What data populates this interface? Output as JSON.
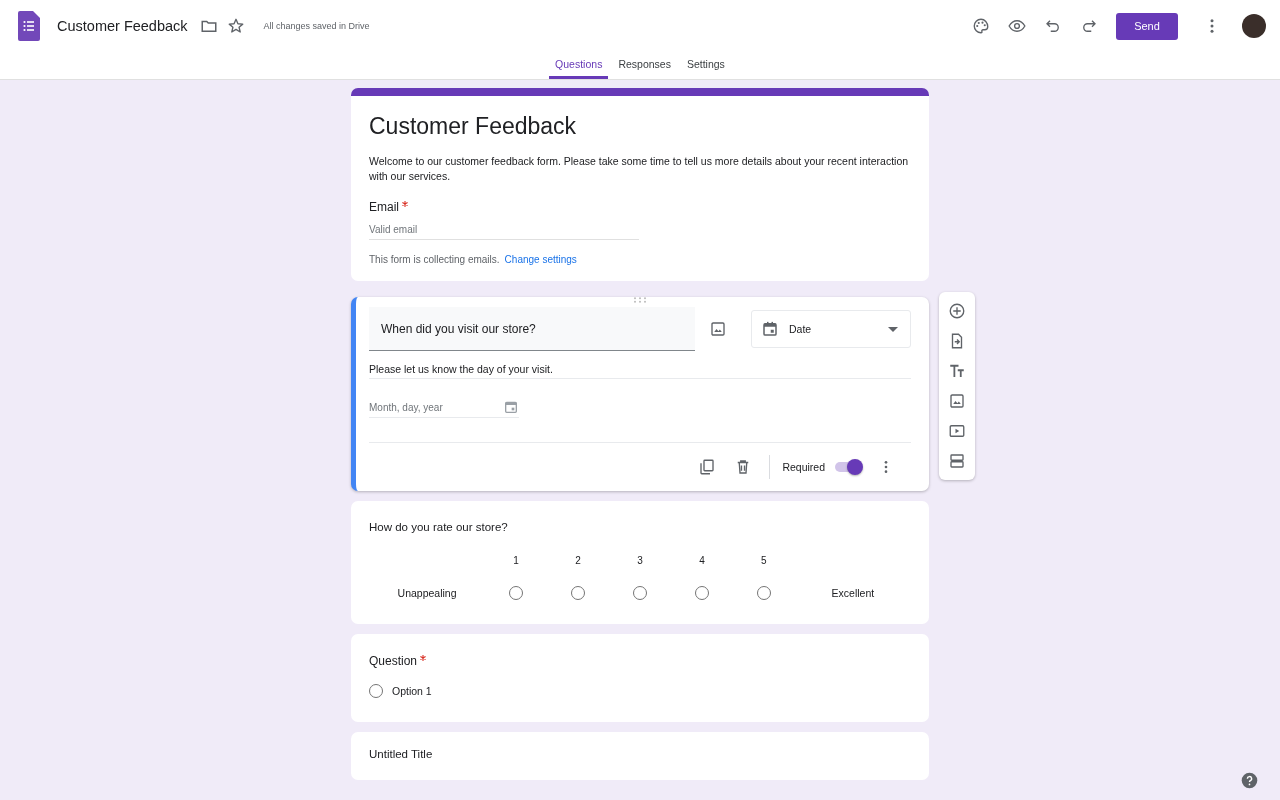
{
  "header": {
    "title": "Customer Feedback",
    "save_status": "All changes saved in Drive",
    "send_label": "Send"
  },
  "tabs": [
    {
      "label": "Questions",
      "selected": true
    },
    {
      "label": "Responses",
      "selected": false
    },
    {
      "label": "Settings",
      "selected": false
    }
  ],
  "form": {
    "title": "Customer Feedback",
    "description": "Welcome to our customer feedback form. Please take some time to tell us more details about your recent interaction with our services.",
    "email_label": "Email",
    "email_required": true,
    "email_placeholder": "Valid email",
    "collecting_note": "This form is collecting emails.",
    "change_link": "Change settings"
  },
  "questions": [
    {
      "kind": "date",
      "focused": true,
      "title": "When did you visit our store?",
      "type_label": "Date",
      "description": "Please let us know the day of your visit.",
      "placeholder": "Month, day, year",
      "required_label": "Required",
      "required": true
    },
    {
      "kind": "scale",
      "focused": false,
      "title": "How do you rate our store?",
      "low_label": "Unappealing",
      "high_label": "Excellent",
      "options": [
        {
          "label": "1",
          "selected": false
        },
        {
          "label": "2",
          "selected": false
        },
        {
          "label": "3",
          "selected": false
        },
        {
          "label": "4",
          "selected": false
        },
        {
          "label": "5",
          "selected": false
        }
      ]
    },
    {
      "kind": "choice",
      "focused": false,
      "title": "Question",
      "required": true,
      "options": [
        {
          "label": "Option 1",
          "selected": false
        }
      ]
    },
    {
      "kind": "untitled",
      "focused": false,
      "title": "Untitled Title"
    }
  ]
}
